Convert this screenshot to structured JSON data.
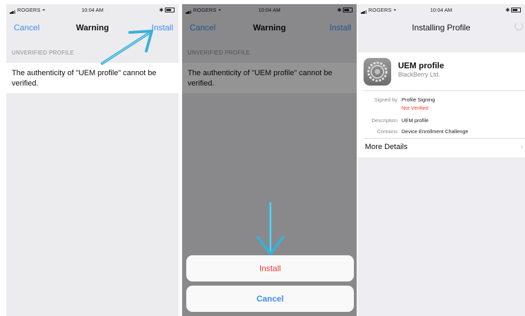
{
  "status_bar": {
    "carrier": "ROGERS",
    "time": "10:04 AM"
  },
  "screen1": {
    "nav": {
      "left": "Cancel",
      "title": "Warning",
      "right": "Install"
    },
    "section_header": "UNVERIFIED PROFILE",
    "warning_text": "The authenticity of \"UEM profile\" cannot be verified."
  },
  "screen2": {
    "nav": {
      "left": "Cancel",
      "title": "Warning",
      "right": "Install"
    },
    "section_header": "UNVERIFIED PROFILE",
    "warning_text": "The authenticity of \"UEM profile\" cannot be verified.",
    "action_sheet": {
      "install": "Install",
      "cancel": "Cancel"
    }
  },
  "screen3": {
    "nav": {
      "title": "Installing Profile"
    },
    "profile": {
      "name": "UEM profile",
      "organization": "BlackBerry Ltd.",
      "signed_by_label": "Signed by",
      "signed_by_value": "Profile Signing",
      "verification_status": "Not Verified",
      "description_label": "Description",
      "description_value": "UEM profile",
      "contains_label": "Contains",
      "contains_value": "Device Enrollment Challenge"
    },
    "more_details": "More Details"
  },
  "icons": {
    "signal": "signal-bars-icon",
    "wifi": "wifi-icon",
    "bluetooth": "bluetooth-icon",
    "battery": "battery-icon",
    "settings": "gear-icon"
  },
  "colors": {
    "accent": "#3f8cf5",
    "destructive": "#ff3b30",
    "annotation_arrow": "#3ab0d8"
  }
}
